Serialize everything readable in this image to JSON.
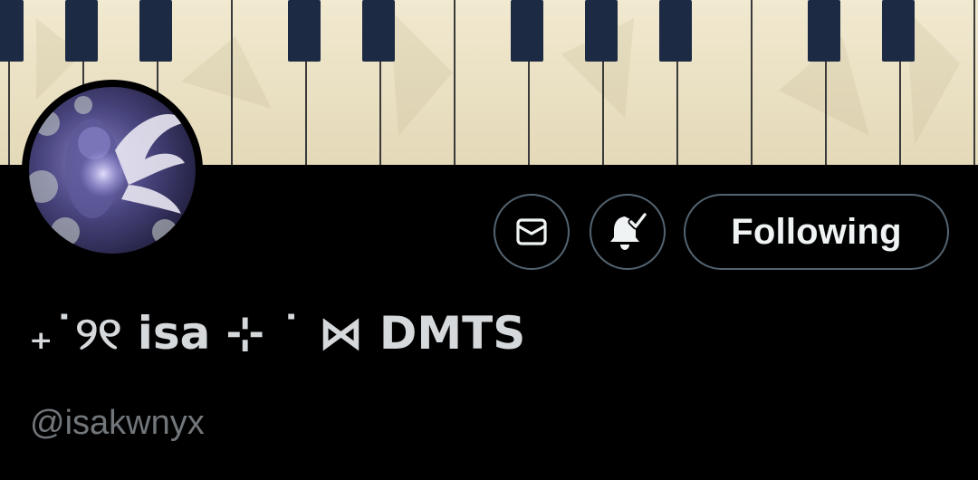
{
  "profile": {
    "display_name": "₊˙୨୧ isa ⊹ ˙ ⋈ DMTS",
    "handle": "@isakwnyx"
  },
  "actions": {
    "following_label": "Following"
  },
  "icons": {
    "message": "mail-envelope-icon",
    "notifications": "bell-check-icon"
  },
  "colors": {
    "background": "#000000",
    "button_border": "#536471",
    "primary_text": "#e7e9ea",
    "secondary_text": "#71767b",
    "piano_white_key": "#ece3c8",
    "piano_black_key": "#1d2a44"
  }
}
